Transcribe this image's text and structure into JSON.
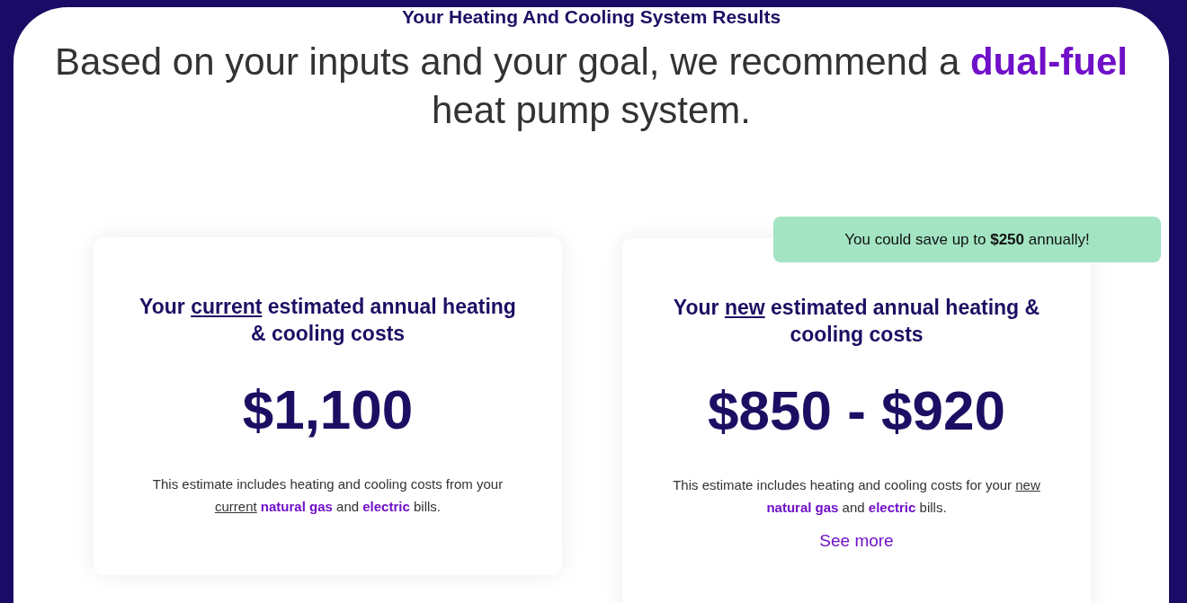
{
  "page": {
    "title": "Your Heating And Cooling System Results",
    "recommendation": [
      {
        "kind": "plain",
        "text": "Based on your inputs and your goal, we recommend a "
      },
      {
        "kind": "highlight",
        "text": "dual-fuel"
      },
      {
        "kind": "plain",
        "text": " heat pump system."
      }
    ]
  },
  "cards": [
    {
      "heading": [
        {
          "kind": "plain",
          "text": "Your "
        },
        {
          "kind": "underline",
          "text": "current"
        },
        {
          "kind": "plain",
          "text": " estimated annual heating & cooling costs"
        }
      ],
      "price": "$1,100",
      "note": [
        {
          "kind": "plain",
          "text": "This estimate includes heating and cooling costs from your "
        },
        {
          "kind": "underline",
          "text": "current"
        },
        {
          "kind": "highlight",
          "text": " natural gas"
        },
        {
          "kind": "plain",
          "text": " and "
        },
        {
          "kind": "highlight",
          "text": "electric"
        },
        {
          "kind": "plain",
          "text": " bills."
        }
      ]
    },
    {
      "heading": [
        {
          "kind": "plain",
          "text": "Your "
        },
        {
          "kind": "underline",
          "text": "new"
        },
        {
          "kind": "plain",
          "text": " estimated annual heating & cooling costs"
        }
      ],
      "price": "$850 - $920",
      "note": [
        {
          "kind": "plain",
          "text": "This estimate includes heating and cooling costs for your "
        },
        {
          "kind": "underline",
          "text": "new"
        },
        {
          "kind": "highlight",
          "text": " natural gas"
        },
        {
          "kind": "plain",
          "text": " and "
        },
        {
          "kind": "highlight",
          "text": "electric"
        },
        {
          "kind": "plain",
          "text": " bills."
        }
      ],
      "link": "See more",
      "badge": "You could save up to **$250** annually!"
    }
  ]
}
